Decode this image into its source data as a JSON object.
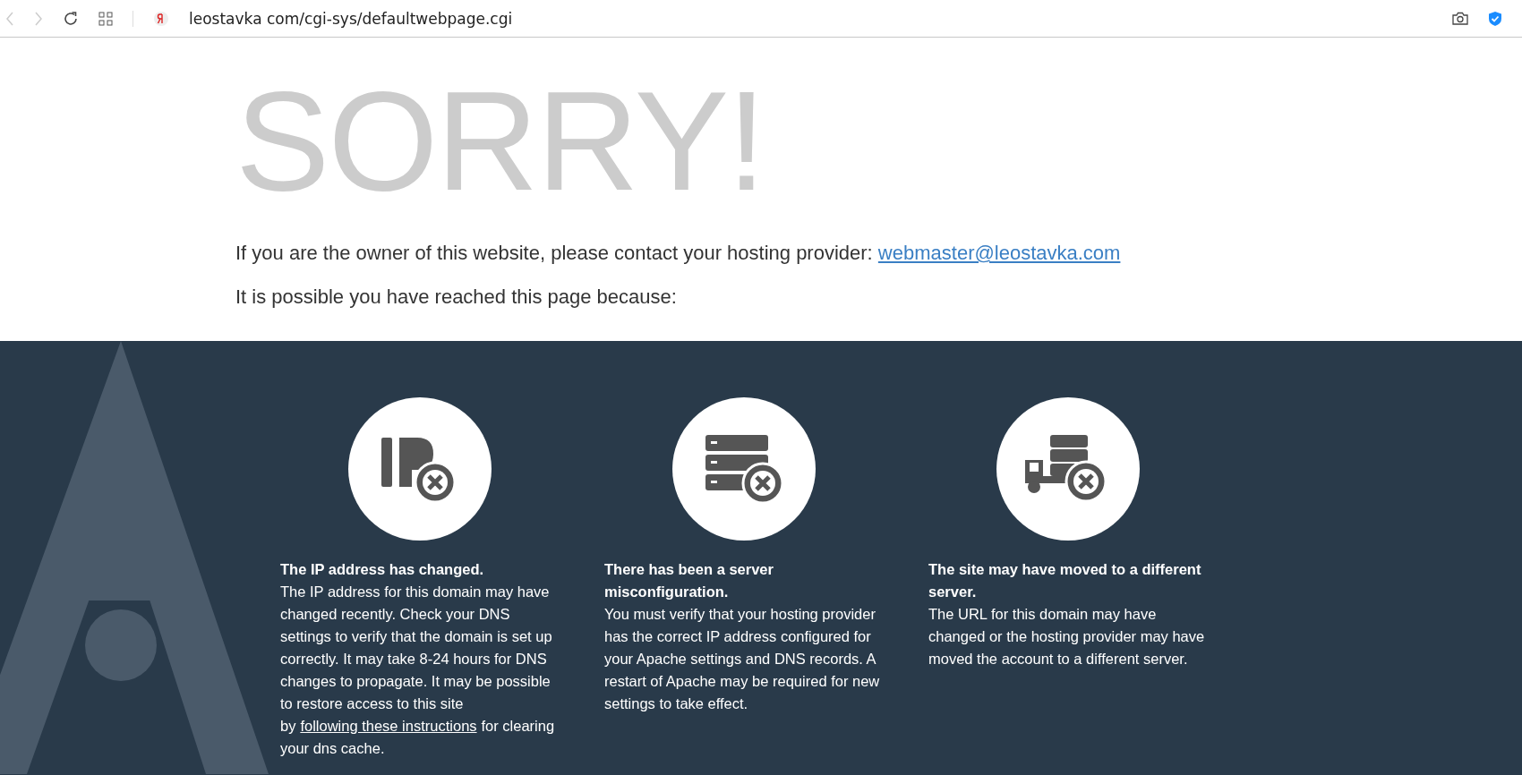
{
  "browser": {
    "url": "leostavka com/cgi-sys/defaultwebpage.cgi"
  },
  "heading": "SORRY!",
  "owner_line": {
    "text": "If you are the owner of this website, please contact your hosting provider:",
    "link": "webmaster@leostavka.com"
  },
  "intro": "It is possible you have reached this page because:",
  "reasons": [
    {
      "kind": "ip",
      "title": "The IP address has changed.",
      "body": "The IP address for this domain may have changed recently. Check your DNS settings to verify that the domain is set up correctly. It may take 8-24 hours for DNS changes to propagate. It may be possible to restore access to this site by",
      "link": "following these instructions",
      "body_after": "for clearing your dns cache."
    },
    {
      "kind": "server",
      "title": "There has been a server misconfiguration.",
      "body": "You must verify that your hosting provider has the correct IP address configured for your Apache settings and DNS records. A restart of Apache may be required for new settings to take effect."
    },
    {
      "kind": "moved",
      "title": "The site may have moved to a different server.",
      "body": "The URL for this domain may have changed or the hosting provider may have moved the account to a different server."
    }
  ]
}
